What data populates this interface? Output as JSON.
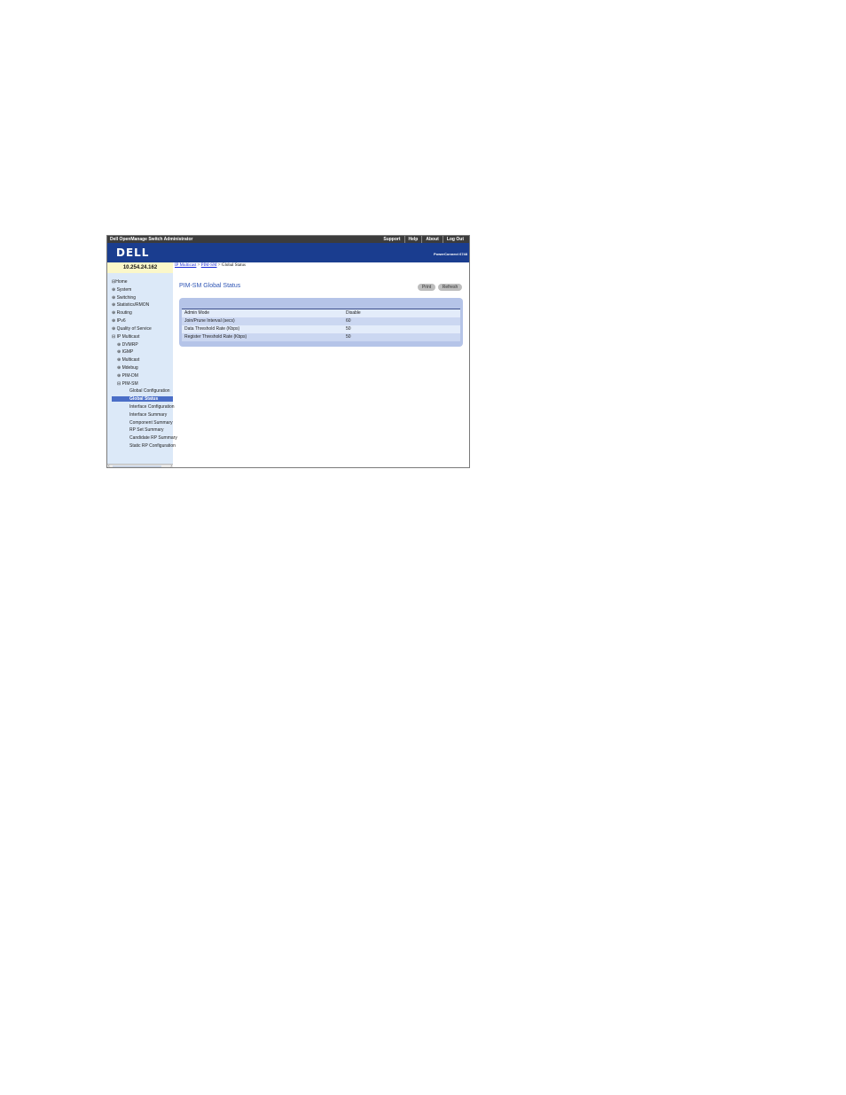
{
  "app": {
    "title": "Dell OpenManage Switch Administrator",
    "top_links": [
      "Support",
      "Help",
      "About",
      "Log Out"
    ],
    "logo": "DELL",
    "model": "PowerConnect 6748"
  },
  "ip_address": "10.254.24.162",
  "breadcrumb": {
    "links": [
      "IP Multicast",
      "PIM-SM"
    ],
    "separator": ">",
    "current": "Global Status"
  },
  "sidebar": {
    "items": [
      {
        "label": "Home",
        "prefix": "⊟"
      },
      {
        "label": "System",
        "prefix": "⊕"
      },
      {
        "label": "Switching",
        "prefix": "⊕"
      },
      {
        "label": "Statistics/RMON",
        "prefix": "⊕"
      },
      {
        "label": "Routing",
        "prefix": "⊕"
      },
      {
        "label": "IPv6",
        "prefix": "⊕"
      },
      {
        "label": "Quality of Service",
        "prefix": "⊕"
      },
      {
        "label": "IP Multicast",
        "prefix": "⊟"
      },
      {
        "label": "DVMRP",
        "prefix": "⊕"
      },
      {
        "label": "IGMP",
        "prefix": "⊕"
      },
      {
        "label": "Multicast",
        "prefix": "⊕"
      },
      {
        "label": "Mdebug",
        "prefix": "⊕"
      },
      {
        "label": "PIM-DM",
        "prefix": "⊕"
      },
      {
        "label": "PIM-SM",
        "prefix": "⊟"
      },
      {
        "label": "Global Configuration",
        "prefix": ""
      },
      {
        "label": "Global Status",
        "prefix": ""
      },
      {
        "label": "Interface Configuration",
        "prefix": ""
      },
      {
        "label": "Interface Summary",
        "prefix": ""
      },
      {
        "label": "Component Summary",
        "prefix": ""
      },
      {
        "label": "RP Set Summary",
        "prefix": ""
      },
      {
        "label": "Candidate RP Summary",
        "prefix": ""
      },
      {
        "label": "Static RP Configuration",
        "prefix": ""
      }
    ],
    "selected": "Global Status"
  },
  "main": {
    "title": "PIM-SM Global Status",
    "buttons": {
      "print": "Print",
      "refresh": "Refresh"
    },
    "rows": [
      {
        "label": "Admin Mode",
        "value": "Disable"
      },
      {
        "label": "Join/Prune Interval (secs)",
        "value": "60"
      },
      {
        "label": "Data Threshold Rate (Kbps)",
        "value": "50"
      },
      {
        "label": "Register Threshold Rate (Kbps)",
        "value": "50"
      }
    ]
  },
  "colors": {
    "banner": "#1a3d8f",
    "sidebar": "#dce9f8",
    "selected": "#4a6ec7",
    "panel": "#b5c4e8",
    "title": "#2f55b5"
  }
}
